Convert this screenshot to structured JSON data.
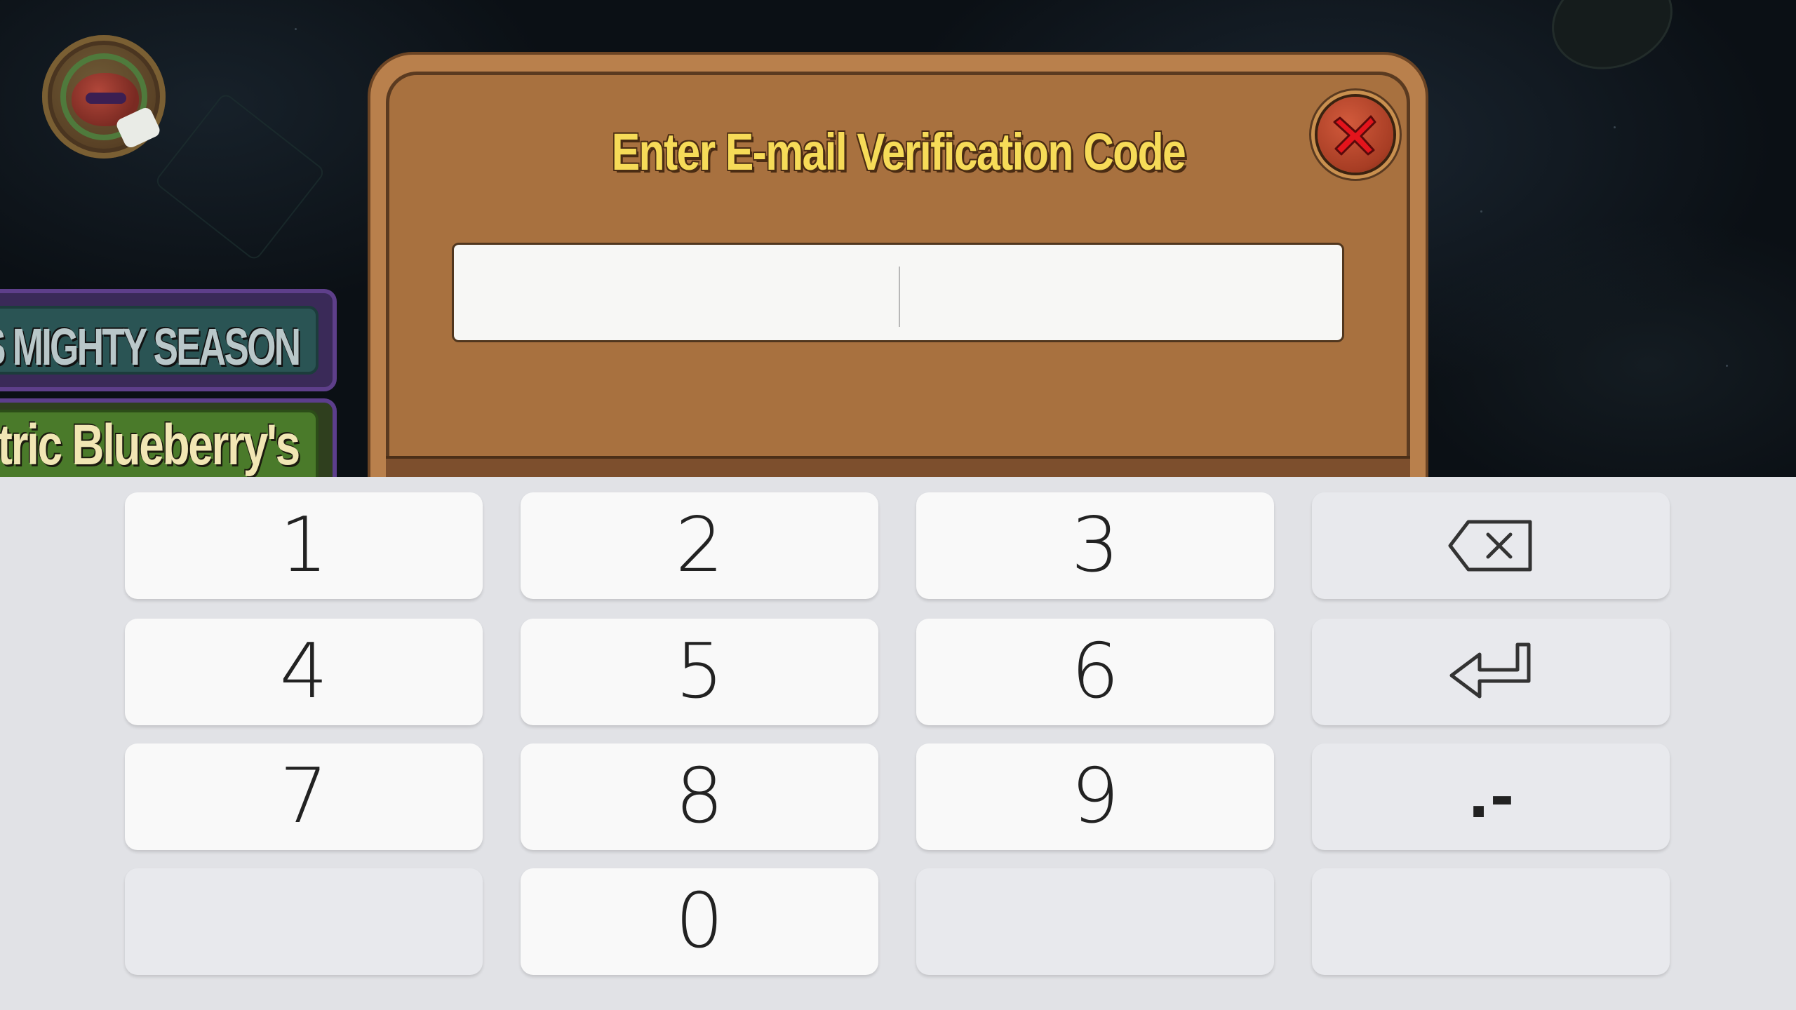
{
  "dialog": {
    "title": "Enter E-mail Verification Code",
    "input_value": "",
    "close_icon": "close-x-icon"
  },
  "background": {
    "banner_season_text": "T'S MIGHTY SEASON",
    "banner_blueberry_text": "ctric Blueberry's"
  },
  "keyboard": {
    "keys": {
      "k1": "1",
      "k2": "2",
      "k3": "3",
      "k4": "4",
      "k5": "5",
      "k6": "6",
      "k7": "7",
      "k8": "8",
      "k9": "9",
      "k0": "0",
      "symbols": ".-"
    },
    "icons": {
      "backspace": "backspace-icon",
      "enter": "enter-icon"
    }
  },
  "colors": {
    "dialog_wood": "#a8713f",
    "title_yellow": "#f6db58",
    "close_red": "#a73d24",
    "keyboard_bg": "#e1e2e6",
    "key_white": "#f9f9f9"
  }
}
